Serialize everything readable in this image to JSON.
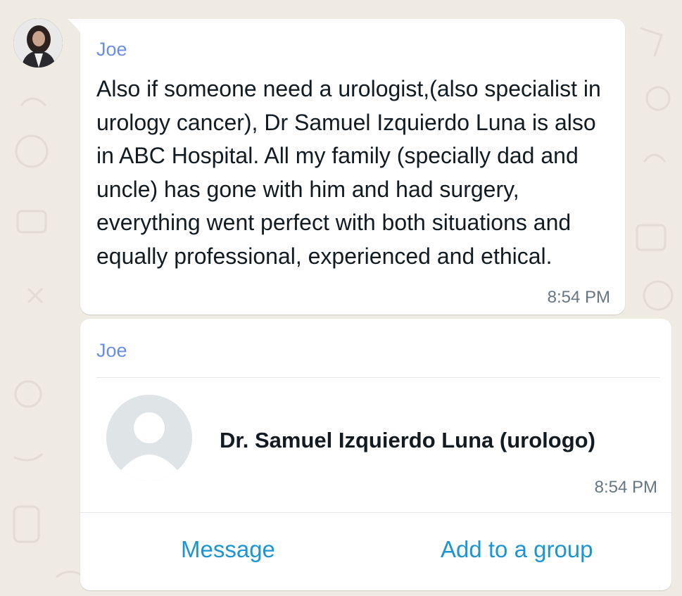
{
  "chat": {
    "message": {
      "sender": "Joe",
      "text": "Also if someone need a urologist,(also specialist in urology cancer), Dr Samuel Izquierdo Luna is also in ABC Hospital. All my family (specially dad and uncle) has gone with him and had surgery, everything went perfect with both situations and equally professional, experienced and ethical.",
      "time": "8:54 PM"
    },
    "contact_card": {
      "sender": "Joe",
      "contact_name": "Dr. Samuel Izquierdo Luna (urologo)",
      "time": "8:54 PM",
      "message_action": "Message",
      "add_group_action": "Add to a group"
    }
  },
  "colors": {
    "background": "#efeae2",
    "bubble": "#ffffff",
    "sender_name": "#6b8fe0",
    "link_action": "#1c95d2",
    "timestamp": "#667781"
  },
  "icons": [
    "user-avatar-photo",
    "default-contact-avatar-icon"
  ]
}
